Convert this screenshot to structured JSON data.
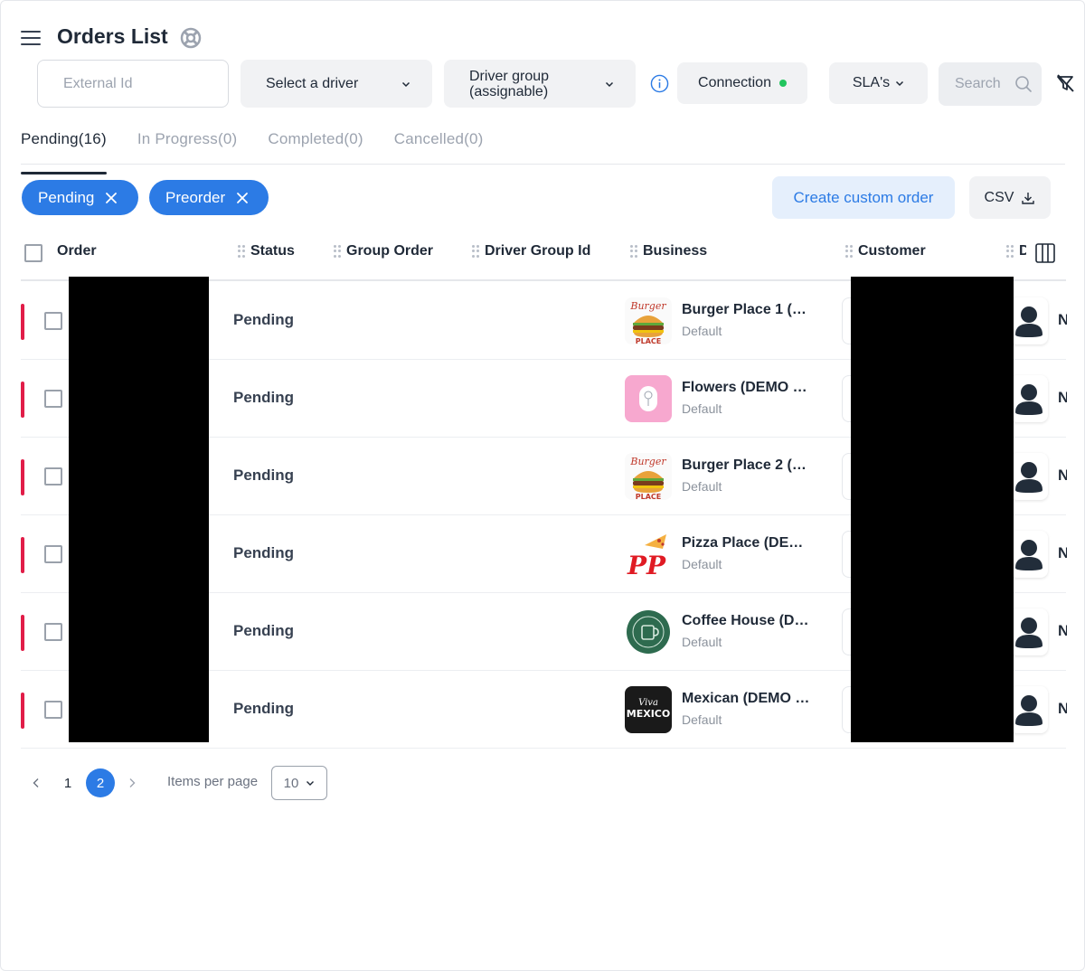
{
  "header": {
    "title": "Orders List"
  },
  "filters": {
    "external_id_placeholder": "External Id",
    "driver_select": "Select a driver",
    "driver_group_select": "Driver group (assignable)",
    "connection_label": "Connection",
    "connection_status_color": "#22c55e",
    "sla_label": "SLA's",
    "search_placeholder": "Search"
  },
  "tabs": [
    {
      "label": "Pending(16)",
      "active": true
    },
    {
      "label": "In Progress(0)",
      "active": false
    },
    {
      "label": "Completed(0)",
      "active": false
    },
    {
      "label": "Cancelled(0)",
      "active": false
    }
  ],
  "chips": [
    {
      "label": "Pending"
    },
    {
      "label": "Preorder"
    }
  ],
  "actions": {
    "create_custom_order": "Create custom order",
    "csv": "CSV"
  },
  "table": {
    "columns": {
      "order": "Order",
      "status": "Status",
      "group_order": "Group Order",
      "driver_group_id": "Driver Group Id",
      "business": "Business",
      "customer": "Customer",
      "truncated": "D"
    },
    "rows": [
      {
        "status": "Pending",
        "business_name": "Burger Place 1 (…",
        "business_type": "Default",
        "logo": "burger-logo",
        "trail": "N"
      },
      {
        "status": "Pending",
        "business_name": "Flowers (DEMO …",
        "business_type": "Default",
        "logo": "flowers-logo",
        "trail": "N"
      },
      {
        "status": "Pending",
        "business_name": "Burger Place 2 (…",
        "business_type": "Default",
        "logo": "burger-logo",
        "trail": "N"
      },
      {
        "status": "Pending",
        "business_name": "Pizza Place (DE…",
        "business_type": "Default",
        "logo": "pizza-logo",
        "trail": "N"
      },
      {
        "status": "Pending",
        "business_name": "Coffee House (D…",
        "business_type": "Default",
        "logo": "coffee-logo",
        "trail": "N"
      },
      {
        "status": "Pending",
        "business_name": "Mexican (DEMO …",
        "business_type": "Default",
        "logo": "mexican-logo",
        "trail": "N"
      }
    ]
  },
  "pagination": {
    "pages": [
      "1",
      "2"
    ],
    "current_page": "2",
    "items_per_page_label": "Items per page",
    "items_per_page_value": "10"
  },
  "colors": {
    "accent": "#2c7be5",
    "pending_bar": "#e11d48"
  }
}
